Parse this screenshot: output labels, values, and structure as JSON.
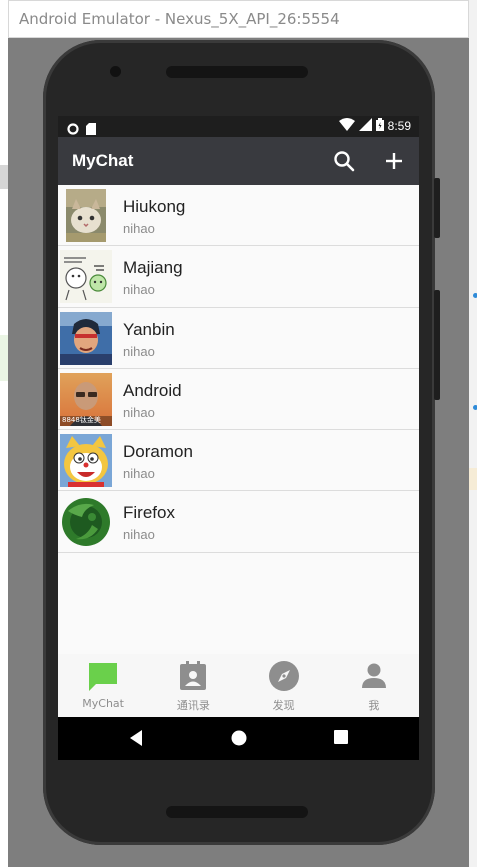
{
  "window": {
    "title": "Android Emulator - Nexus_5X_API_26:5554"
  },
  "status_bar": {
    "time": "8:59"
  },
  "app": {
    "title": "MyChat",
    "toolbar_icons": [
      "search-icon",
      "plus-icon"
    ]
  },
  "chats": [
    {
      "name": "Hiukong",
      "message": "nihao",
      "avatar": "kitten-avatar"
    },
    {
      "name": "Majiang",
      "message": "nihao",
      "avatar": "sticker-avatar"
    },
    {
      "name": "Yanbin",
      "message": "nihao",
      "avatar": "anime-avatar"
    },
    {
      "name": "Android",
      "message": "nihao",
      "avatar": "man-avatar",
      "avatar_caption": "8848钛金美"
    },
    {
      "name": "Doramon",
      "message": "nihao",
      "avatar": "cat-avatar"
    },
    {
      "name": "Firefox",
      "message": "nihao",
      "avatar": "firefox-avatar"
    }
  ],
  "bottom_nav": [
    {
      "label": "MyChat",
      "icon": "chat-icon",
      "active": true
    },
    {
      "label": "通讯录",
      "icon": "contacts-icon",
      "active": false
    },
    {
      "label": "发现",
      "icon": "compass-icon",
      "active": false
    },
    {
      "label": "我",
      "icon": "person-icon",
      "active": false
    }
  ],
  "colors": {
    "toolbar": "#393a3f",
    "active_tab": "#6ad04b",
    "inactive_tab": "#8e8e8e",
    "status_bar": "#1e1e1e"
  }
}
